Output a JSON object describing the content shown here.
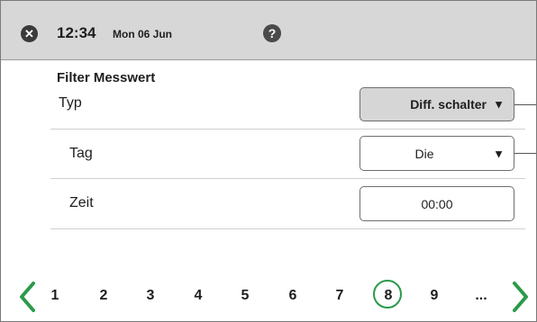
{
  "status_bar": {
    "time": "12:34",
    "date": "Mon 06 Jun"
  },
  "section": {
    "title": "Filter Messwert"
  },
  "rows": [
    {
      "label": "Typ",
      "value": "Diff. schalter"
    },
    {
      "label": "Tag",
      "value": "Die"
    },
    {
      "label": "Zeit",
      "value": "00:00"
    }
  ],
  "pagination": {
    "pages": [
      "1",
      "2",
      "3",
      "4",
      "5",
      "6",
      "7",
      "8",
      "9",
      "..."
    ],
    "active_page": "8"
  },
  "colors": {
    "accent": "#2b9a4a",
    "header_bg": "#d7d7d7",
    "field_grey": "#d6d6d6"
  },
  "icons": {
    "close": "close-icon",
    "help": "help-icon",
    "prev": "chevron-left-icon",
    "next": "chevron-right-icon",
    "dropdown": "caret-down-icon"
  }
}
